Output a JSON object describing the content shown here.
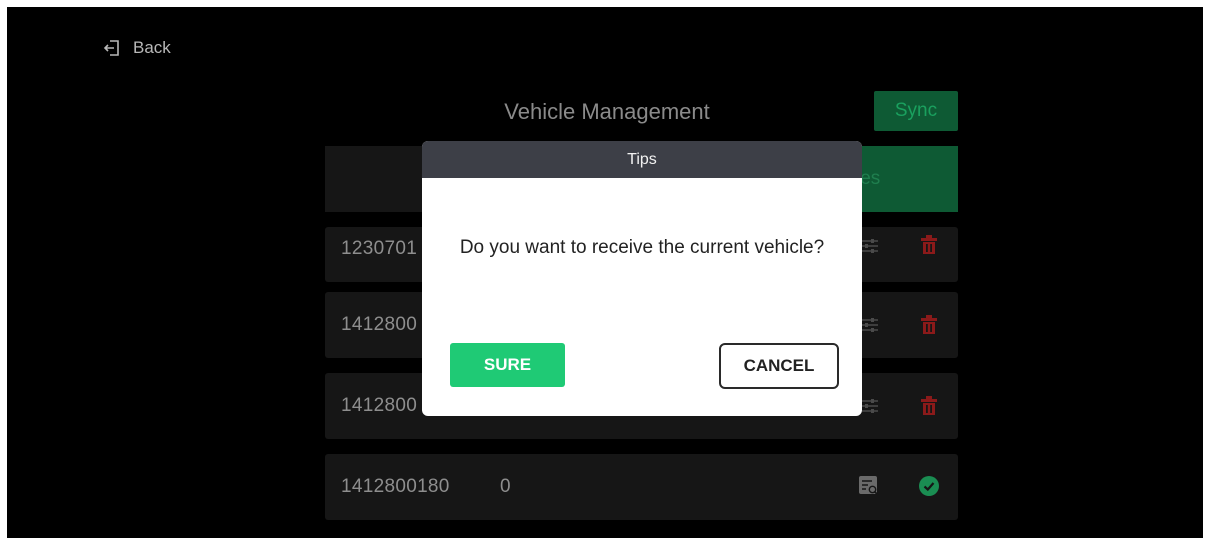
{
  "header": {
    "back_label": "Back",
    "title": "Vehicle Management",
    "sync_label": "Sync"
  },
  "tabs": {
    "active_partial_label": "les"
  },
  "vehicles": [
    {
      "id_visible": "1230701",
      "status": "unselected"
    },
    {
      "id_visible": "1412800",
      "status": "unselected"
    },
    {
      "id_visible": "1412800",
      "status": "unselected"
    },
    {
      "id_visible": "1412800180",
      "number": "0",
      "status": "current"
    }
  ],
  "dialog": {
    "title": "Tips",
    "message": "Do you want to receive the current vehicle?",
    "confirm_label": "SURE",
    "cancel_label": "CANCEL"
  },
  "icons": {
    "back": "exit-arrow-icon",
    "settings": "sliders-icon",
    "delete": "trash-icon",
    "details": "document-search-icon",
    "current": "check-circle-icon"
  },
  "colors": {
    "accent_green": "#1fca75",
    "dim_green": "#0e5a34",
    "delete_red": "#8b1a1a",
    "dialog_header": "#3d3f47"
  }
}
